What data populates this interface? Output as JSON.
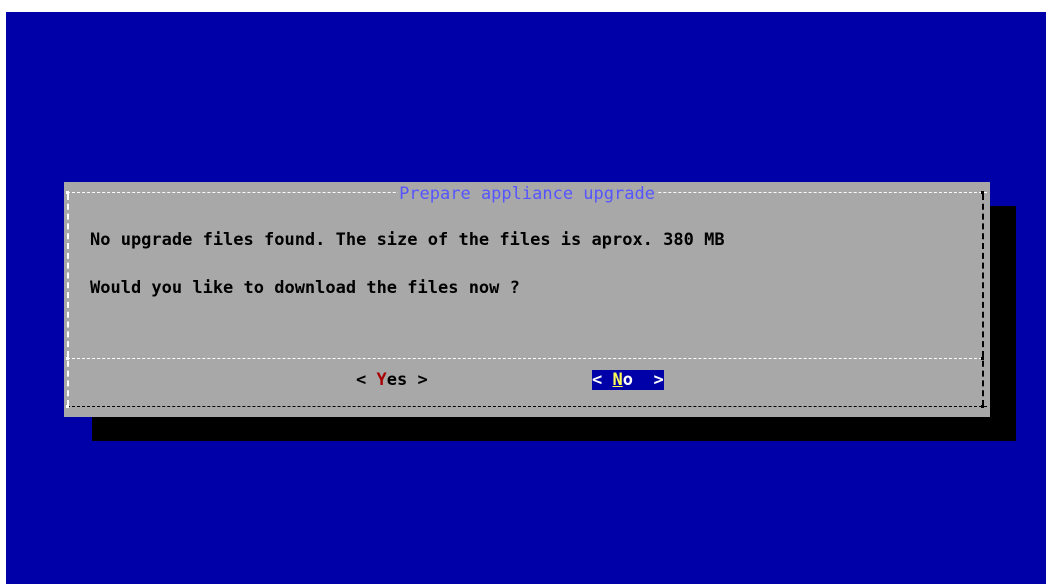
{
  "dialog": {
    "title": "Prepare appliance upgrade",
    "message_line1": "No upgrade files found. The size of the files is aprox. 380 MB",
    "message_line2": "Would you like to download the files now ?"
  },
  "buttons": {
    "yes": {
      "left": "< ",
      "hotkey": "Y",
      "rest": "es >",
      "selected": false
    },
    "no": {
      "left": "< ",
      "hotkey": "N",
      "rest": "o  >",
      "selected": true
    }
  },
  "colors": {
    "background": "#0000a8",
    "dialog": "#a8a8a8",
    "shadow": "#000000",
    "title": "#5555ff",
    "hotkey": "#a80000",
    "selected_hotkey": "#ffff55"
  }
}
